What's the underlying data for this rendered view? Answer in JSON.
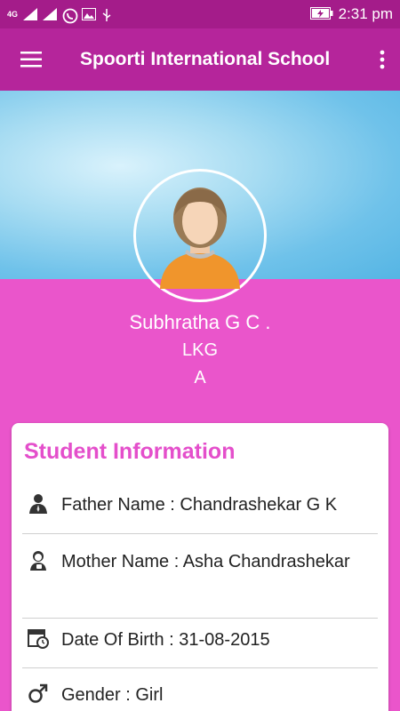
{
  "status_bar": {
    "network": "4G",
    "time": "2:31 pm",
    "icons": [
      "signal-icon",
      "signal-icon",
      "whatsapp-icon",
      "image-icon",
      "usb-icon",
      "battery-charging-icon"
    ]
  },
  "app_bar": {
    "title": "Spoorti International School",
    "menu_icon": "hamburger-menu-icon",
    "more_icon": "more-vert-icon"
  },
  "profile": {
    "name": "Subhratha G C .",
    "class": "LKG",
    "section": "A"
  },
  "student_info": {
    "heading": "Student Information",
    "rows": [
      {
        "icon": "father-icon",
        "text": "Father Name   : Chandrashekar G K"
      },
      {
        "icon": "mother-icon",
        "text": "Mother Name   : Asha Chandrashekar"
      },
      {
        "icon": "calendar-icon",
        "text": "Date Of Birth : 31-08-2015"
      },
      {
        "icon": "male-gender-icon",
        "text": "Gender       : Girl"
      }
    ]
  },
  "colors": {
    "status_bar": "#a41c8a",
    "app_bar": "#b5259b",
    "background": "#ea55cb",
    "heading": "#e44fcb"
  }
}
